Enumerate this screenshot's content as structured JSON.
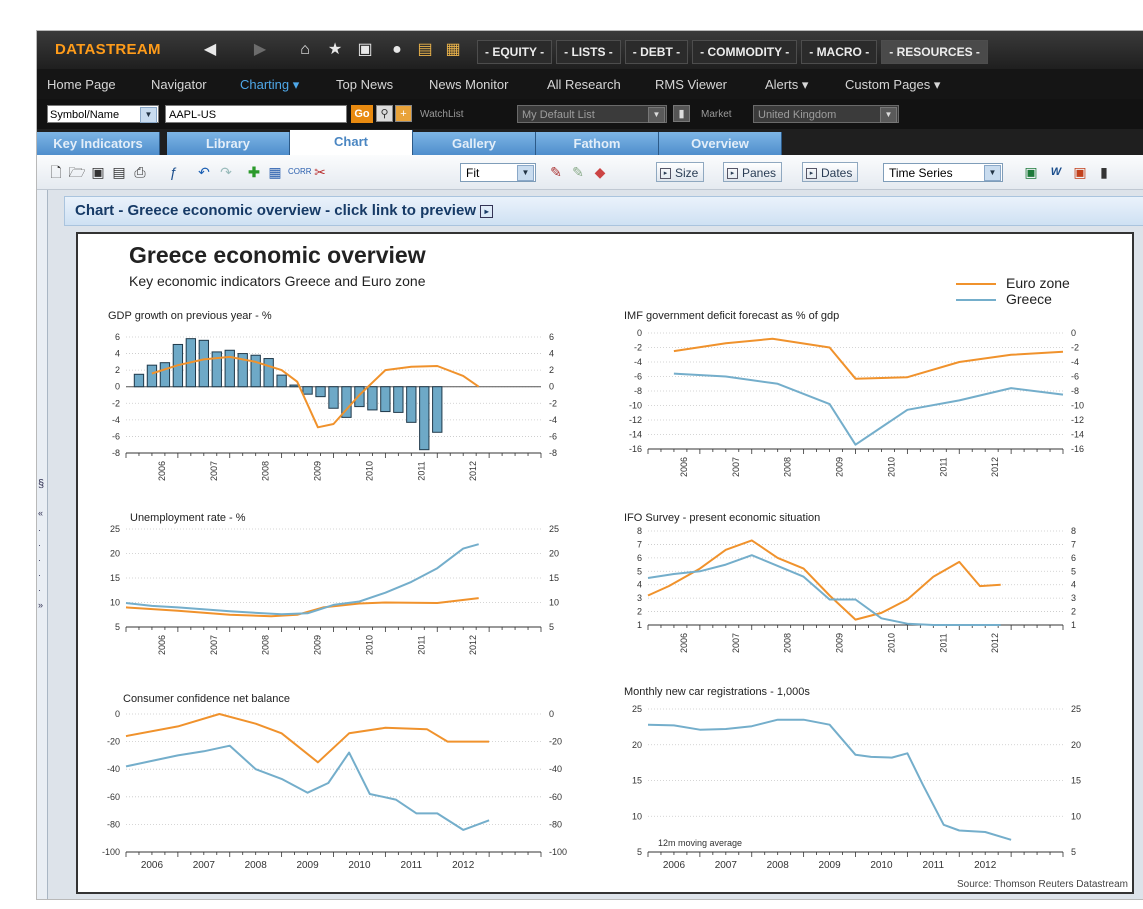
{
  "app": {
    "brand": "DATASTREAM",
    "menus": [
      "- EQUITY -",
      "- LISTS -",
      "- DEBT -",
      "- COMMODITY -",
      "- MACRO -",
      "- RESOURCES -"
    ]
  },
  "nav": {
    "items": [
      "Home Page",
      "Navigator",
      "Charting ▾",
      "Top News",
      "News Monitor",
      "All Research",
      "RMS Viewer",
      "Alerts ▾",
      "Custom Pages ▾"
    ]
  },
  "symbol_bar": {
    "selector": "Symbol/Name",
    "symbol_value": "AAPL-US",
    "go_label": "Go",
    "watchlist_label": "WatchList",
    "watchlist_value": "My Default List",
    "market_label": "Market",
    "market_value": "United Kingdom"
  },
  "tabs": [
    "Key Indicators",
    "Library",
    "Chart",
    "Gallery",
    "Fathom",
    "Overview"
  ],
  "toolbar": {
    "fit_value": "Fit",
    "size_label": "Size",
    "panes_label": "Panes",
    "dates_label": "Dates",
    "series_type": "Time Series"
  },
  "chart_header": "Chart - Greece economic overview - click link to preview",
  "chart_panel": {
    "title": "Greece economic overview",
    "subtitle": "Key economic indicators Greece and Euro zone",
    "legend": [
      {
        "name": "Euro zone",
        "color": "#f0922c"
      },
      {
        "name": "Greece",
        "color": "#74aecb"
      }
    ],
    "source": "Source: Thomson Reuters Datastream"
  },
  "chart_data": [
    {
      "type": "bar",
      "title": "GDP growth on previous year - %",
      "ylim": [
        -8,
        6
      ],
      "yticks": [
        6,
        4,
        2,
        0,
        -2,
        -4,
        -6,
        -8
      ],
      "xticks": [
        "2006",
        "2007",
        "2008",
        "2009",
        "2010",
        "2011",
        "2012"
      ],
      "series": [
        {
          "name": "Greece",
          "values": [
            1.5,
            2.6,
            2.9,
            5.1,
            5.8,
            5.6,
            4.2,
            4.4,
            4.0,
            3.8,
            3.4,
            1.4,
            0.2,
            -0.9,
            -1.2,
            -2.6,
            -3.7,
            -2.4,
            -2.8,
            -3.0,
            -3.1,
            -4.3,
            -7.6,
            -5.5
          ]
        },
        {
          "name": "Euro zone",
          "x": [
            2005.5,
            2006.0,
            2006.5,
            2007.0,
            2007.5,
            2008.0,
            2008.3,
            2008.7,
            2009.0,
            2009.5,
            2010.0,
            2010.5,
            2011.0,
            2011.5,
            2011.8
          ],
          "values": [
            1.6,
            2.6,
            3.3,
            3.6,
            3.0,
            2.0,
            0.6,
            -4.9,
            -4.5,
            -1.0,
            2.0,
            2.4,
            2.5,
            1.3,
            0.0
          ]
        }
      ]
    },
    {
      "type": "line",
      "title": "IMF government deficit forecast as % of gdp",
      "ylim": [
        -16,
        0
      ],
      "yticks": [
        0,
        -2,
        -4,
        -6,
        -8,
        -10,
        -12,
        -14,
        -16
      ],
      "xticks": [
        "2006",
        "2007",
        "2008",
        "2009",
        "2010",
        "2011",
        "2012"
      ],
      "series": [
        {
          "name": "Euro zone",
          "x": [
            2005.5,
            2006.5,
            2007.4,
            2008.5,
            2009.0,
            2010.0,
            2011.0,
            2012.0,
            2013.0
          ],
          "values": [
            -2.5,
            -1.4,
            -0.8,
            -2.0,
            -6.3,
            -6.1,
            -4.0,
            -3.0,
            -2.6
          ]
        },
        {
          "name": "Greece",
          "x": [
            2005.5,
            2006.5,
            2007.5,
            2008.5,
            2009.0,
            2010.0,
            2011.0,
            2012.0,
            2013.0
          ],
          "values": [
            -5.6,
            -6.0,
            -7.0,
            -9.8,
            -15.4,
            -10.6,
            -9.3,
            -7.6,
            -8.5
          ]
        }
      ]
    },
    {
      "type": "line",
      "title": "Unemployment rate - %",
      "ylim": [
        5,
        25
      ],
      "yticks": [
        25,
        20,
        15,
        10,
        5
      ],
      "xticks": [
        "2006",
        "2007",
        "2008",
        "2009",
        "2010",
        "2011",
        "2012"
      ],
      "series": [
        {
          "name": "Euro zone",
          "x": [
            2005.0,
            2006.0,
            2007.0,
            2007.8,
            2008.3,
            2008.8,
            2009.5,
            2010.0,
            2011.0,
            2011.8
          ],
          "values": [
            9.0,
            8.3,
            7.5,
            7.2,
            7.5,
            9.0,
            9.8,
            10.0,
            9.9,
            10.9
          ]
        },
        {
          "name": "Greece",
          "x": [
            2005.0,
            2005.5,
            2006.0,
            2007.0,
            2008.0,
            2008.5,
            2009.0,
            2009.5,
            2010.0,
            2010.5,
            2011.0,
            2011.5,
            2011.8
          ],
          "values": [
            9.9,
            9.3,
            9.0,
            8.2,
            7.6,
            7.8,
            9.5,
            10.2,
            12.0,
            14.2,
            17.0,
            21.0,
            21.9
          ]
        }
      ]
    },
    {
      "type": "line",
      "title": "IFO Survey - present economic situation",
      "ylim": [
        1,
        8
      ],
      "yticks": [
        8,
        7,
        6,
        5,
        4,
        3,
        2,
        1
      ],
      "xticks": [
        "2006",
        "2007",
        "2008",
        "2009",
        "2010",
        "2011",
        "2012"
      ],
      "series": [
        {
          "name": "Euro zone",
          "x": [
            2005.0,
            2005.4,
            2006.0,
            2006.5,
            2007.0,
            2007.5,
            2008.0,
            2008.5,
            2009.0,
            2009.5,
            2010.0,
            2010.5,
            2011.0,
            2011.4,
            2011.8
          ],
          "values": [
            3.2,
            3.9,
            5.2,
            6.6,
            7.3,
            6.0,
            5.2,
            3.2,
            1.4,
            1.9,
            2.9,
            4.6,
            5.7,
            3.9,
            4.0
          ]
        },
        {
          "name": "Greece",
          "x": [
            2005.0,
            2005.5,
            2006.0,
            2006.5,
            2007.0,
            2007.5,
            2008.0,
            2008.5,
            2009.0,
            2009.5,
            2010.0,
            2010.5,
            2011.0,
            2011.8
          ],
          "values": [
            4.5,
            4.8,
            5.0,
            5.5,
            6.2,
            5.4,
            4.6,
            2.9,
            2.9,
            1.5,
            1.1,
            1.0,
            1.0,
            1.0
          ]
        }
      ]
    },
    {
      "type": "line",
      "title": "Consumer confidence net balance",
      "ylim": [
        -100,
        0
      ],
      "yticks": [
        0,
        -20,
        -40,
        -60,
        -80,
        -100
      ],
      "xticks": [
        "2006",
        "2007",
        "2008",
        "2009",
        "2010",
        "2011",
        "2012"
      ],
      "series": [
        {
          "name": "Euro zone",
          "x": [
            2005.0,
            2006.0,
            2006.8,
            2007.5,
            2008.0,
            2008.7,
            2009.3,
            2010.0,
            2010.8,
            2011.2,
            2012.0
          ],
          "values": [
            -16,
            -9,
            0,
            -7,
            -14,
            -35,
            -14,
            -10,
            -11,
            -20,
            -20
          ]
        },
        {
          "name": "Greece",
          "x": [
            2005.0,
            2005.5,
            2006.0,
            2006.5,
            2007.0,
            2007.5,
            2008.0,
            2008.5,
            2008.9,
            2009.3,
            2009.7,
            2010.2,
            2010.6,
            2011.0,
            2011.5,
            2012.0
          ],
          "values": [
            -38,
            -34,
            -30,
            -27,
            -23,
            -40,
            -47,
            -57,
            -50,
            -28,
            -58,
            -62,
            -72,
            -72,
            -84,
            -77
          ]
        }
      ]
    },
    {
      "type": "line",
      "title": "Monthly new car registrations - 1,000s",
      "note": "12m moving average",
      "ylim": [
        5,
        25
      ],
      "yticks": [
        25,
        20,
        15,
        10,
        5
      ],
      "xticks": [
        "2006",
        "2007",
        "2008",
        "2009",
        "2010",
        "2011",
        "2012"
      ],
      "series": [
        {
          "name": "Greece",
          "x": [
            2005.0,
            2005.5,
            2006.0,
            2006.5,
            2007.0,
            2007.5,
            2008.0,
            2008.5,
            2009.0,
            2009.3,
            2009.7,
            2010.0,
            2010.3,
            2010.7,
            2011.0,
            2011.5,
            2012.0
          ],
          "values": [
            22.8,
            22.7,
            22.1,
            22.2,
            22.6,
            23.5,
            23.5,
            22.8,
            18.6,
            18.3,
            18.2,
            18.8,
            14.4,
            8.8,
            8.0,
            7.8,
            6.7
          ]
        }
      ]
    }
  ]
}
